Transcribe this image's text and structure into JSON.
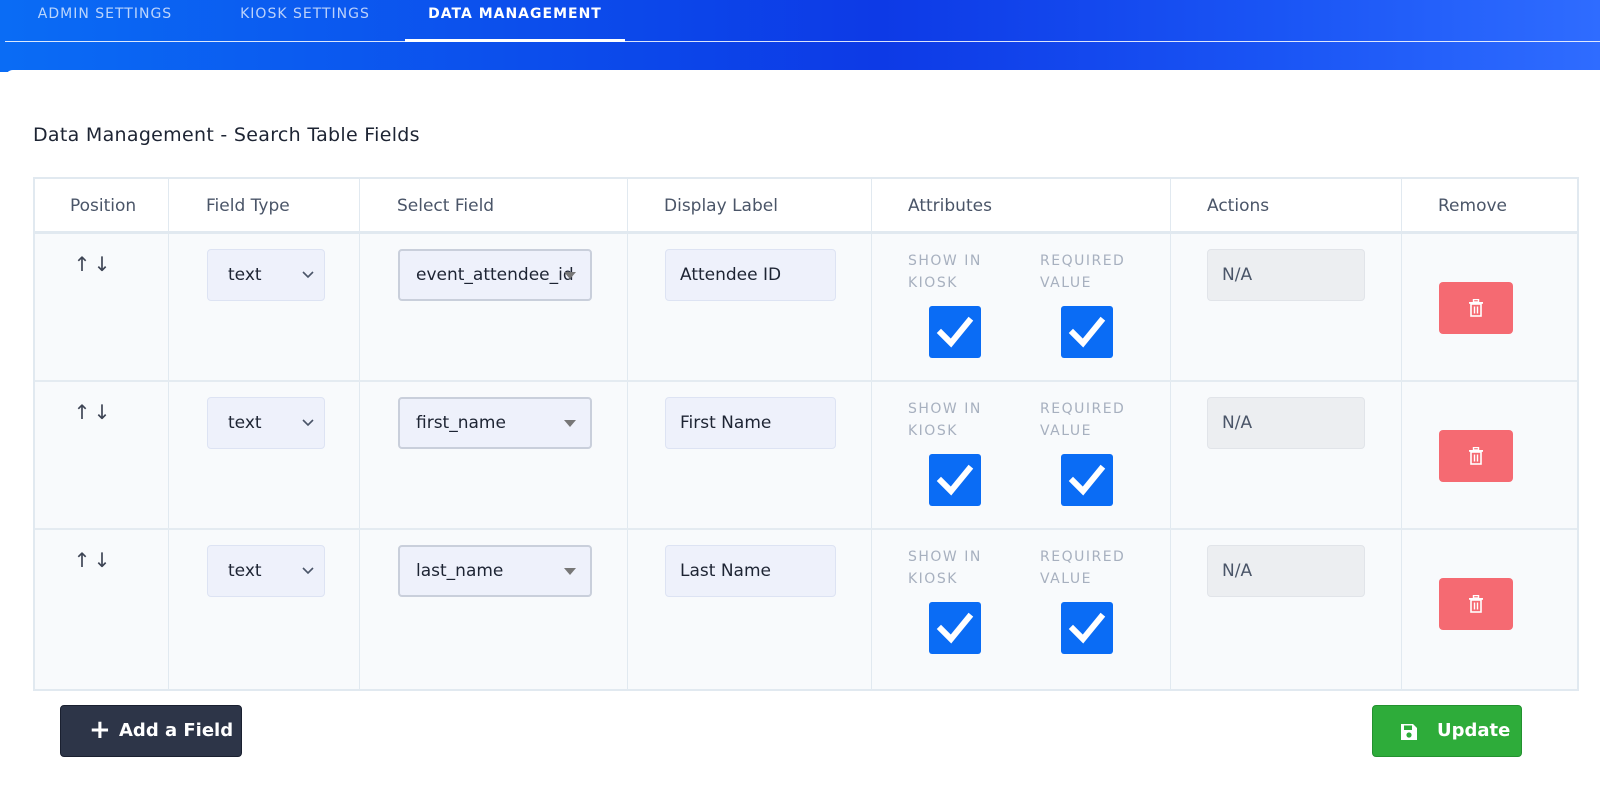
{
  "tabs": [
    {
      "label": "ADMIN SETTINGS"
    },
    {
      "label": "KIOSK SETTINGS"
    },
    {
      "label": "DATA MANAGEMENT"
    }
  ],
  "section_title": "Data Management - Search Table Fields",
  "columns": [
    "Position",
    "Field Type",
    "Select Field",
    "Display Label",
    "Attributes",
    "Actions",
    "Remove"
  ],
  "attribute_labels": {
    "show_in_kiosk": "SHOW IN\nKIOSK",
    "required_value": "REQUIRED\nVALUE"
  },
  "rows": [
    {
      "field_type": "text",
      "select_field": "event_attendee_id",
      "display_label": "Attendee ID",
      "show_in_kiosk": true,
      "required_value": true,
      "action": "N/A"
    },
    {
      "field_type": "text",
      "select_field": "first_name",
      "display_label": "First Name",
      "show_in_kiosk": true,
      "required_value": true,
      "action": "N/A"
    },
    {
      "field_type": "text",
      "select_field": "last_name",
      "display_label": "Last Name",
      "show_in_kiosk": true,
      "required_value": true,
      "action": "N/A"
    }
  ],
  "buttons": {
    "add_field": "Add a Field",
    "update": "Update"
  },
  "colors": {
    "accent": "#0a6cf5",
    "remove": "#f56a72",
    "update": "#2eac3a",
    "add": "#2d3548"
  },
  "icons": {
    "up": "↑",
    "down": "↓",
    "plus": "+"
  }
}
